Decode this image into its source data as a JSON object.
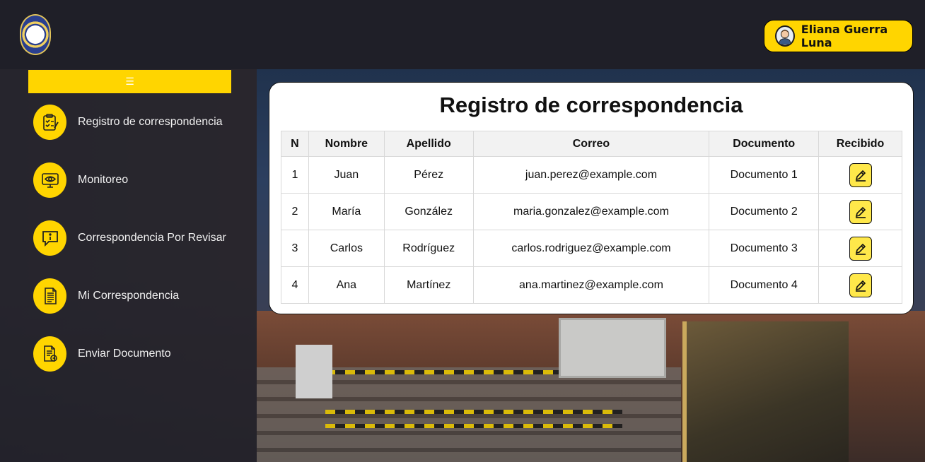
{
  "user": {
    "name": "Eliana Guerra Luna"
  },
  "sidebar": {
    "toggle_icon": "☰",
    "items": [
      {
        "label": "Registro de correspondencia",
        "icon": "clipboard-check-icon"
      },
      {
        "label": "Monitoreo",
        "icon": "monitor-eye-icon"
      },
      {
        "label": "Correspondencia Por Revisar",
        "icon": "info-bubble-icon"
      },
      {
        "label": "Mi Correspondencia",
        "icon": "document-lines-icon"
      },
      {
        "label": "Enviar Documento",
        "icon": "document-send-icon"
      }
    ]
  },
  "main": {
    "title": "Registro de correspondencia",
    "table": {
      "headers": [
        "N",
        "Nombre",
        "Apellido",
        "Correo",
        "Documento",
        "Recibido"
      ],
      "rows": [
        [
          "1",
          "Juan",
          "Pérez",
          "juan.perez@example.com",
          "Documento 1"
        ],
        [
          "2",
          "María",
          "González",
          "maria.gonzalez@example.com",
          "Documento 2"
        ],
        [
          "3",
          "Carlos",
          "Rodríguez",
          "carlos.rodriguez@example.com",
          "Documento 3"
        ],
        [
          "4",
          "Ana",
          "Martínez",
          "ana.martinez@example.com",
          "Documento 4"
        ]
      ]
    }
  },
  "colors": {
    "accent": "#ffd500",
    "edit_button": "#ffe84a",
    "header_bg": "#1f1f28"
  }
}
